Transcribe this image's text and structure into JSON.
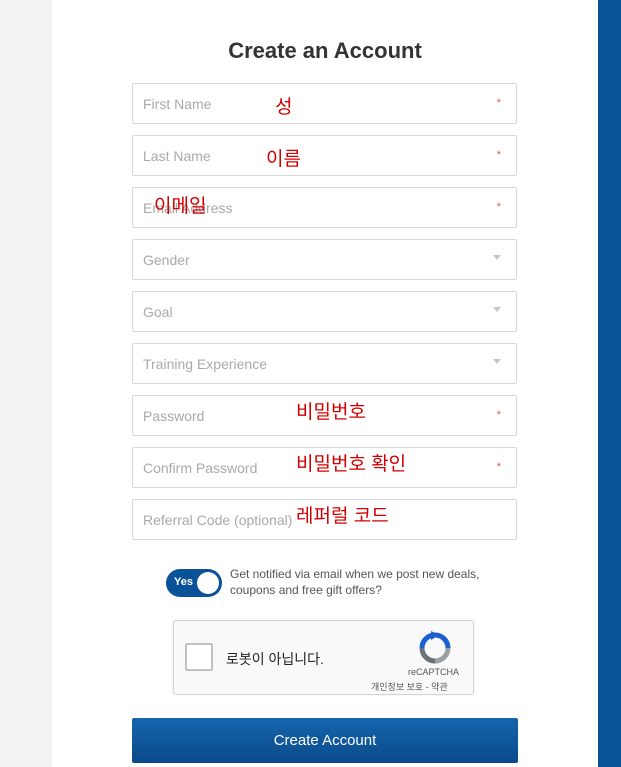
{
  "form": {
    "title": "Create an Account",
    "fields": [
      {
        "placeholder": "First Name",
        "required_mark": "*",
        "annotation": "성"
      },
      {
        "placeholder": "Last Name",
        "required_mark": "*",
        "annotation": "이름"
      },
      {
        "placeholder": "Email Address",
        "required_mark": "*",
        "annotation": "이메일"
      },
      {
        "placeholder": "Gender"
      },
      {
        "placeholder": "Goal"
      },
      {
        "placeholder": "Training Experience"
      },
      {
        "placeholder": "Password",
        "required_mark": "*",
        "annotation": "비밀번호"
      },
      {
        "placeholder": "Confirm Password",
        "required_mark": "*",
        "annotation": "비밀번호 확인"
      },
      {
        "placeholder": "Referral Code (optional)",
        "annotation": "레퍼럴 코드"
      }
    ],
    "toggle": {
      "label": "Yes",
      "on": true
    },
    "notify_text": "Get notified via email when we post new deals, coupons and free gift offers?",
    "captcha": {
      "label": "로봇이 아닙니다.",
      "brand": "reCAPTCHA",
      "links": "개인정보 보호 - 약관"
    },
    "submit_label": "Create Account"
  },
  "colors": {
    "accent": "#0a5298",
    "required": "#e05a5a",
    "annotation": "#d20000"
  }
}
